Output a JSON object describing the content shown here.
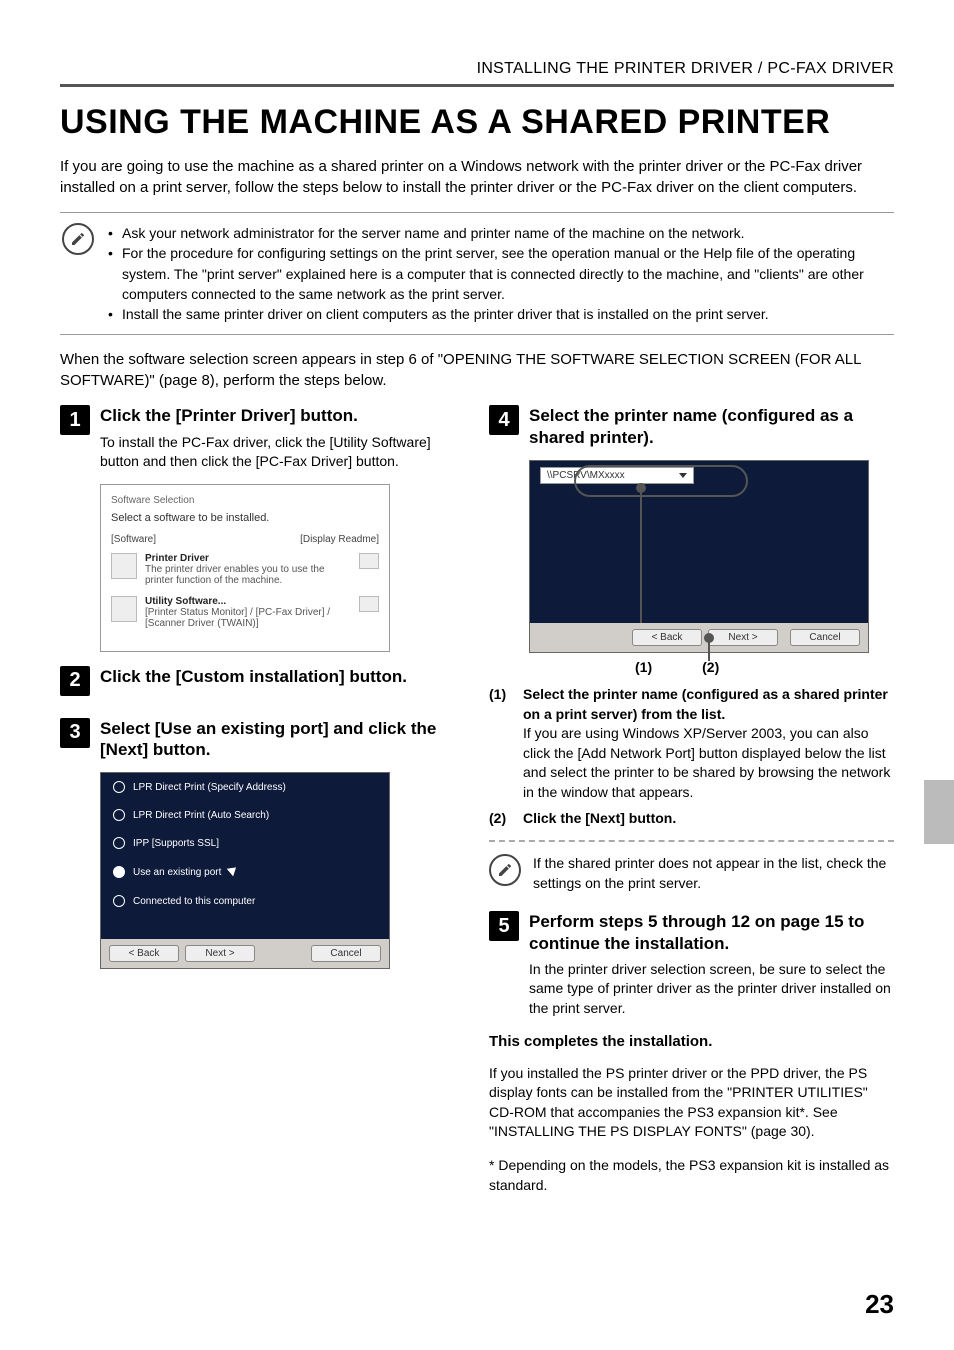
{
  "header": {
    "section": "INSTALLING THE PRINTER DRIVER / PC-FAX DRIVER",
    "title": "USING THE MACHINE AS A SHARED PRINTER",
    "intro": "If you are going to use the machine as a shared printer on a Windows network with the printer driver or the PC-Fax driver installed on a print server, follow the steps below to install the printer driver or the PC-Fax driver on the client computers.",
    "lead2": "When the software selection screen appears in step 6 of \"OPENING THE SOFTWARE SELECTION SCREEN (FOR ALL SOFTWARE)\" (page 8), perform the steps below."
  },
  "notes": [
    "Ask your network administrator for the server name and printer name of the machine on the network.",
    "For the procedure for configuring settings on the print server, see the operation manual or the Help file of the operating system. The \"print server\" explained here is a computer that is connected directly to the machine, and \"clients\" are other computers connected to the same network as the print server.",
    "Install the same printer driver on client computers as the printer driver that is installed on the print server."
  ],
  "steps": [
    {
      "num": "1",
      "title": "Click the [Printer Driver] button.",
      "subtext": "To install the PC-Fax driver, click the [Utility Software] button and then click the [PC-Fax Driver] button."
    },
    {
      "num": "2",
      "title": "Click the [Custom installation] button."
    },
    {
      "num": "3",
      "title": "Select [Use an existing port] and click the [Next] button."
    },
    {
      "num": "4",
      "title": "Select the printer name (configured as a shared printer).",
      "sub": [
        {
          "num": "(1)",
          "head": "Select the printer name (configured as a shared printer on a print server) from the list.",
          "body": "If you are using Windows XP/Server 2003, you can also click the [Add Network Port] button displayed below the list and select the printer to be shared by browsing the network in the window that appears."
        },
        {
          "num": "(2)",
          "head": "Click the [Next] button."
        }
      ],
      "mininote": "If the shared printer does not appear in the list, check the settings on the print server."
    },
    {
      "num": "5",
      "title": "Perform steps 5 through 12 on page 15 to continue the installation.",
      "subtext": "In the printer driver selection screen, be sure to select the same type of printer driver as the printer driver installed on the print server."
    }
  ],
  "dialog1": {
    "windowTitle": "Software Selection",
    "prompt": "Select a software to be installed.",
    "linkLeft": "[Software]",
    "linkRight": "[Display Readme]",
    "items": [
      {
        "name": "Printer Driver",
        "desc": "The printer driver enables you to use the printer function of the machine."
      },
      {
        "name": "Utility Software...",
        "desc": "[Printer Status Monitor] / [PC-Fax Driver] / [Scanner Driver (TWAIN)]"
      }
    ]
  },
  "dialog2": {
    "options": [
      "LPR Direct Print (Specify Address)",
      "LPR Direct Print (Auto Search)",
      "IPP [Supports SSL]",
      "Use an existing port",
      "Connected to this computer"
    ],
    "buttons": {
      "back": "< Back",
      "next": "Next >",
      "cancel": "Cancel"
    }
  },
  "dialog3": {
    "comboValue": "\\\\PCSRV\\MXxxxx",
    "buttons": {
      "back": "< Back",
      "next": "Next >",
      "cancel": "Cancel"
    },
    "callouts": [
      "(1)",
      "(2)"
    ]
  },
  "tail": {
    "complete": "This completes the installation.",
    "after": "If you installed the PS printer driver or the PPD driver, the PS display fonts can be installed from the \"PRINTER UTILITIES\" CD-ROM that accompanies the PS3 expansion kit*. See \"INSTALLING THE PS DISPLAY FONTS\" (page 30).",
    "footnote": "* Depending on the models, the PS3 expansion kit is installed as standard."
  },
  "pageNumber": "23"
}
